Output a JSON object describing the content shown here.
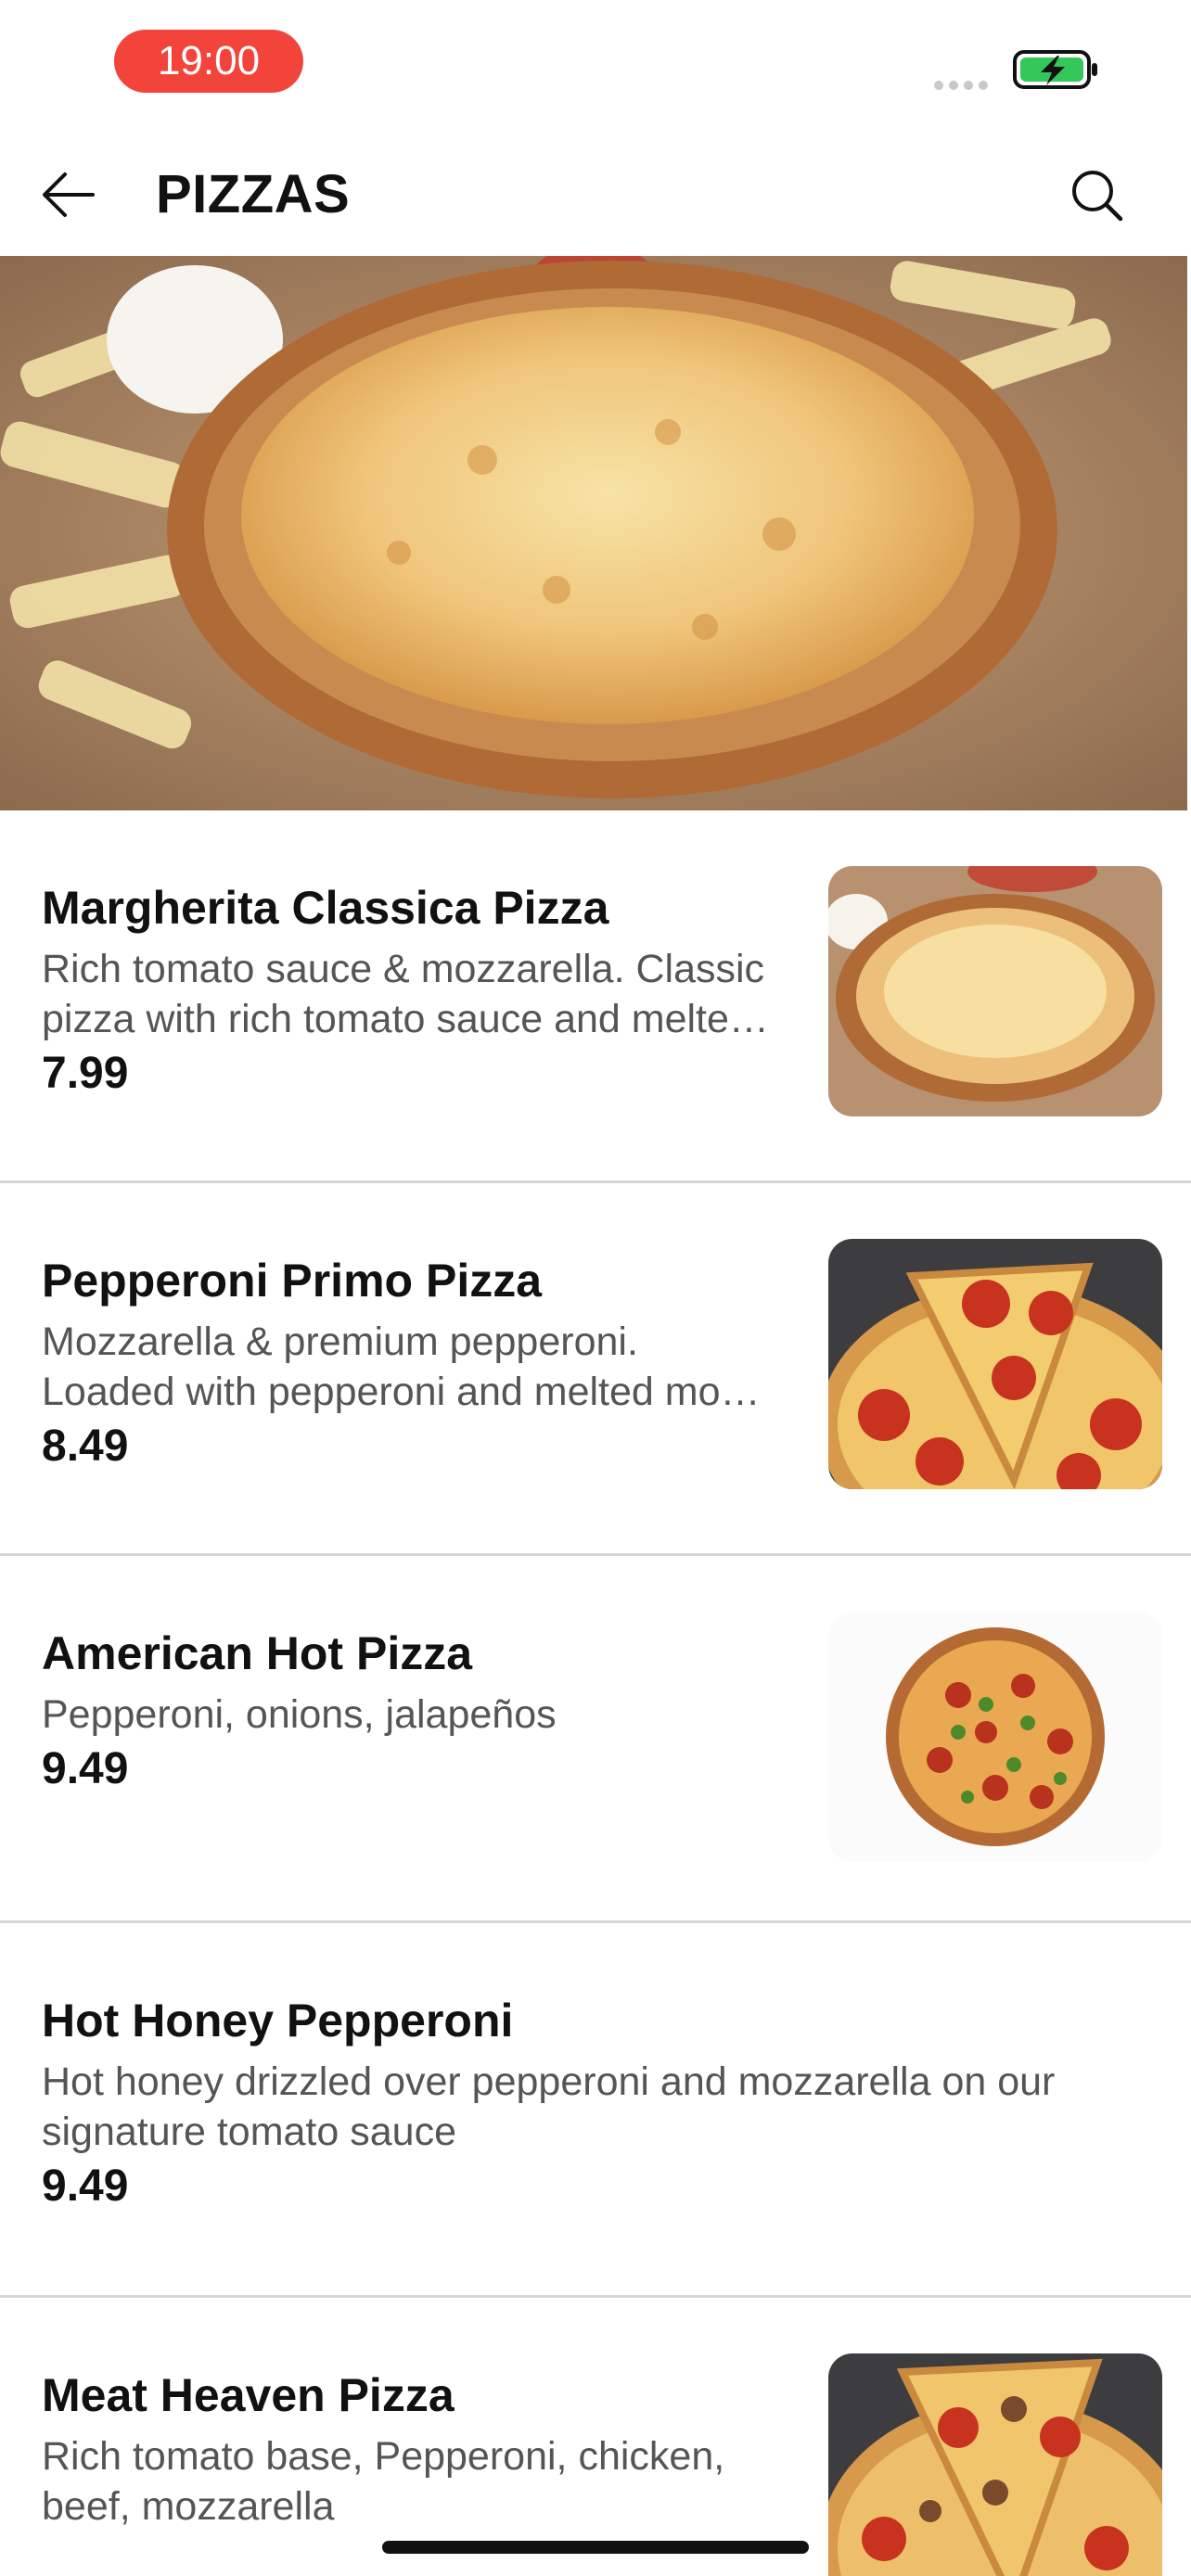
{
  "status_bar": {
    "time": "19:00"
  },
  "header": {
    "title": "PIZZAS"
  },
  "items": [
    {
      "name": "Margherita Classica Pizza",
      "desc_line1": "Rich tomato sauce & mozzarella. Classic",
      "desc_line2": "pizza with rich tomato sauce and melte…",
      "price": "7.99"
    },
    {
      "name": "Pepperoni Primo Pizza",
      "desc_line1": "Mozzarella & premium pepperoni.",
      "desc_line2": "Loaded with pepperoni and melted mo…",
      "price": "8.49"
    },
    {
      "name": "American Hot Pizza",
      "desc_line1": "Pepperoni, onions, jalapeños",
      "price": "9.49"
    },
    {
      "name": "Hot Honey Pepperoni",
      "desc_line1": "Hot honey drizzled over pepperoni and mozzarella on our",
      "desc_line2": "signature tomato sauce",
      "price": "9.49"
    },
    {
      "name": "Meat Heaven Pizza",
      "desc_line1": "Rich tomato base, Pepperoni, chicken,",
      "desc_line2": "beef, mozzarella"
    }
  ],
  "colors": {
    "accent": "#f2443a",
    "battery": "#34c759"
  },
  "icons": {
    "back": "arrow-left-icon",
    "search": "search-icon"
  }
}
